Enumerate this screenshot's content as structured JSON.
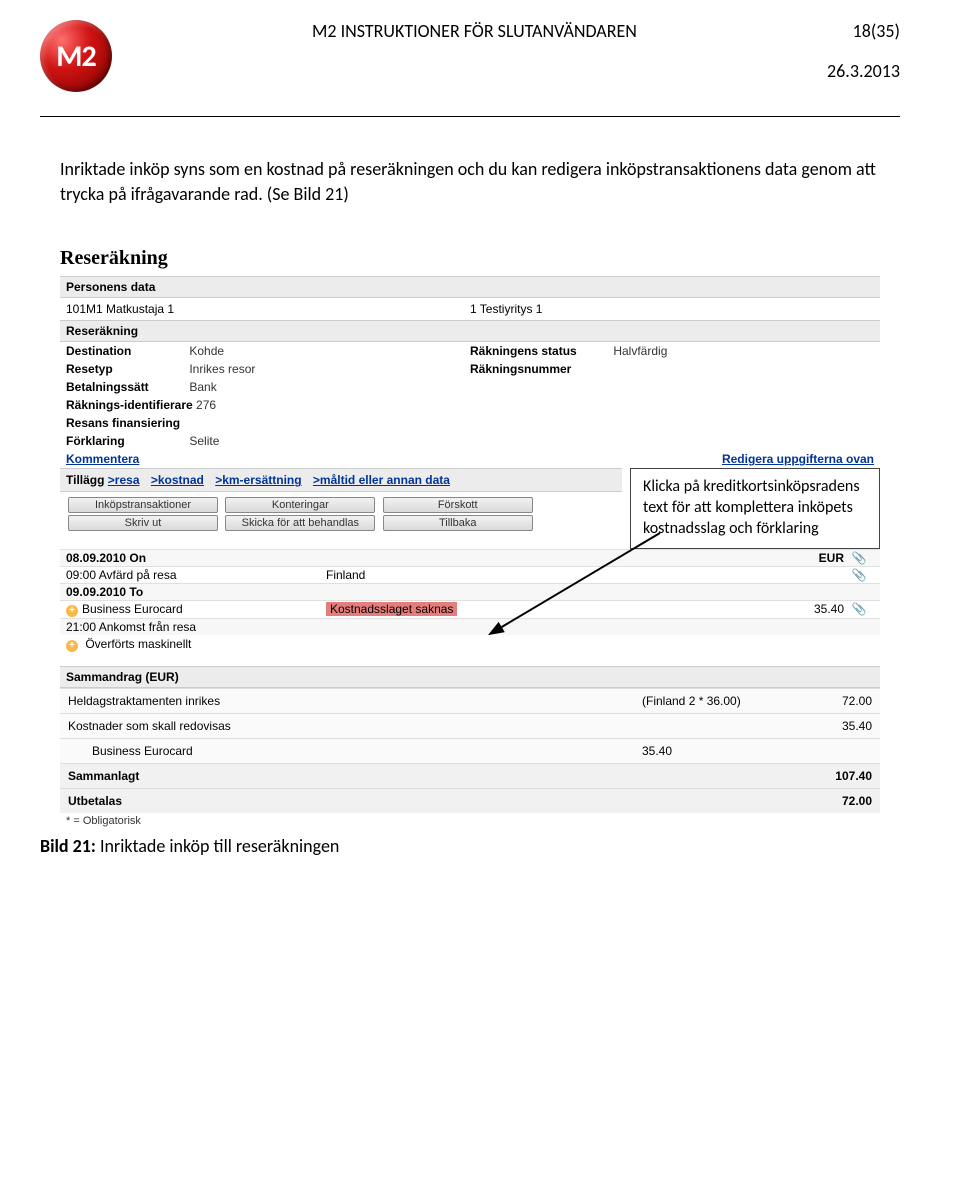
{
  "header": {
    "logo_text": "M2",
    "title": "M2 INSTRUKTIONER FÖR SLUTANVÄNDAREN",
    "page_number": "18(35)",
    "date": "26.3.2013"
  },
  "intro_text": "Inriktade inköp syns som en kostnad på reseräkningen och du kan redigera inköpstransaktionens data genom att trycka på ifrågavarande rad. (Se Bild 21)",
  "app": {
    "title": "Reseräkning",
    "sections": {
      "person": {
        "header": "Personens data",
        "left": "101M1 Matkustaja 1",
        "right": "1 Testiyritys 1"
      },
      "invoice": {
        "header": "Reseräkning",
        "destination_lbl": "Destination",
        "destination_val": "Kohde",
        "status_lbl": "Räkningens status",
        "status_val": "Halvfärdig",
        "type_lbl": "Resetyp",
        "type_val": "Inrikes resor",
        "number_lbl": "Räkningsnummer",
        "number_val": "",
        "pay_lbl": "Betalningssätt",
        "pay_val": "Bank",
        "id_lbl": "Räknings-identifierare",
        "id_val": "276",
        "fin_lbl": "Resans finansiering",
        "fin_val": "",
        "desc_lbl": "Förklaring",
        "desc_val": "Selite",
        "comment_link": "Kommentera",
        "edit_link": "Redigera uppgifterna ovan"
      },
      "add": {
        "label": "Tillägg",
        "items": [
          ">resa",
          ">kostnad",
          ">km-ersättning",
          ">måltid eller annan data"
        ]
      },
      "buttons_row1": [
        "Inköpstransaktioner",
        "Konteringar",
        "Förskott"
      ],
      "buttons_row2": [
        "Skriv ut",
        "Skicka för att behandlas",
        "Tillbaka"
      ],
      "events": [
        {
          "c1": "08.09.2010 On",
          "c2": "",
          "c3": "EUR",
          "date": true,
          "clip": true
        },
        {
          "c1": "09:00 Avfärd på resa",
          "c2": "Finland",
          "c3": "",
          "clip": true
        },
        {
          "c1": "09.09.2010 To",
          "c2": "",
          "c3": "",
          "date": true
        },
        {
          "c1": "Business Eurocard",
          "c2": "Kostnadsslaget saknas",
          "c3": "35.40",
          "plus": true,
          "hl": true,
          "clip": true
        },
        {
          "c1": "21:00 Ankomst från resa",
          "c2": "",
          "c3": ""
        }
      ],
      "machine_note": "Överförts maskinellt",
      "summary": {
        "header": "Sammandrag (EUR)",
        "rows": [
          {
            "s1": "Heldagstraktamenten inrikes",
            "s2": "(Finland 2 * 36.00)",
            "s3": "72.00"
          },
          {
            "s1": "Kostnader som skall redovisas",
            "s2": "",
            "s3": "35.40"
          },
          {
            "s1": "Business Eurocard",
            "s2": "35.40",
            "s3": "",
            "indent": true
          },
          {
            "s1": "Sammanlagt",
            "s2": "",
            "s3": "107.40",
            "bold": true
          },
          {
            "s1": "Utbetalas",
            "s2": "",
            "s3": "72.00",
            "bold": true
          }
        ]
      },
      "mandatory": "* = Obligatorisk"
    },
    "callout": "Klicka på kreditkortsinköpsradens text för att komplettera inköpets kostnadsslag och förklaring"
  },
  "caption_label": "Bild 21:",
  "caption_text": " Inriktade inköp till reseräkningen"
}
